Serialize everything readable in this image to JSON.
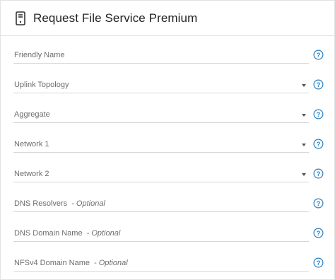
{
  "dialog": {
    "title": "Request File Service Premium",
    "icon": "server-icon"
  },
  "fields": [
    {
      "id": "friendly-name",
      "label": "Friendly Name",
      "optional": "",
      "type": "text"
    },
    {
      "id": "uplink-topology",
      "label": "Uplink Topology",
      "optional": "",
      "type": "select"
    },
    {
      "id": "aggregate",
      "label": "Aggregate",
      "optional": "",
      "type": "select"
    },
    {
      "id": "network-1",
      "label": "Network 1",
      "optional": "",
      "type": "select"
    },
    {
      "id": "network-2",
      "label": "Network 2",
      "optional": "",
      "type": "select"
    },
    {
      "id": "dns-resolvers",
      "label": "DNS Resolvers",
      "optional": "- Optional",
      "type": "text"
    },
    {
      "id": "dns-domain-name",
      "label": "DNS Domain Name",
      "optional": "- Optional",
      "type": "text"
    },
    {
      "id": "nfsv4-domain-name",
      "label": "NFSv4 Domain Name",
      "optional": "- Optional",
      "type": "text"
    }
  ],
  "colors": {
    "accent": "#2a7fc1",
    "label": "#6d6d6d",
    "divider": "#e2e2e2"
  }
}
